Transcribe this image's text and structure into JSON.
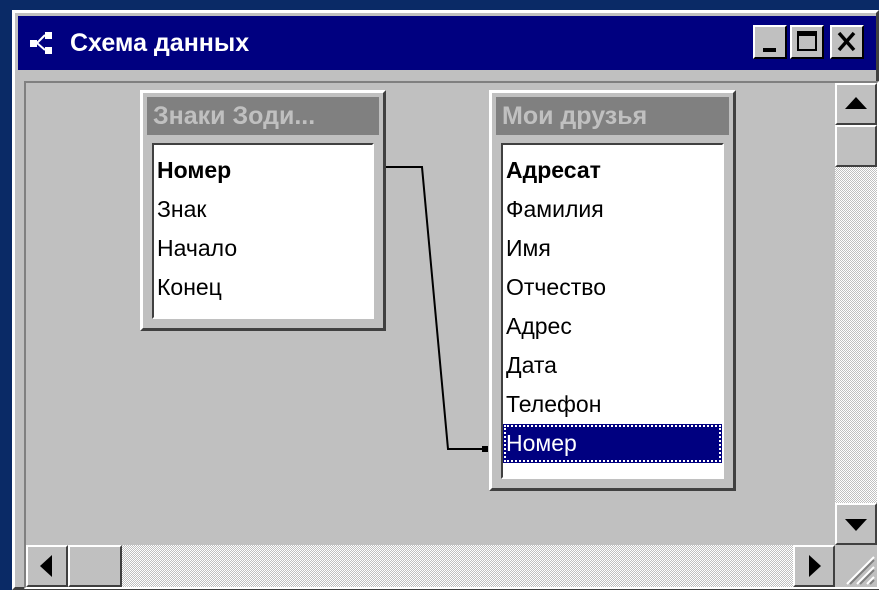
{
  "window": {
    "title": "Схема данных",
    "icon": "relationships-icon",
    "controls": [
      "minimize-icon",
      "maximize-icon",
      "close-icon"
    ]
  },
  "tables": [
    {
      "title": "Знаки Зоди...",
      "fields": [
        {
          "name": "Номер",
          "primary_key": true
        },
        {
          "name": "Знак"
        },
        {
          "name": "Начало"
        },
        {
          "name": "Конец"
        }
      ]
    },
    {
      "title": "Мои друзья",
      "fields": [
        {
          "name": "Адресат",
          "primary_key": true
        },
        {
          "name": "Фамилия"
        },
        {
          "name": "Имя"
        },
        {
          "name": "Отчество"
        },
        {
          "name": "Адрес"
        },
        {
          "name": "Дата"
        },
        {
          "name": "Телефон"
        },
        {
          "name": "Номер",
          "selected": true
        }
      ]
    }
  ],
  "relationship": {
    "from": "Знаки Зоди....Номер",
    "to": "Мои друзья.Номер"
  },
  "colors": {
    "desktop": "#0a2a66",
    "title_bar": "#000080",
    "face": "#c0c0c0",
    "selection": "#000080"
  }
}
